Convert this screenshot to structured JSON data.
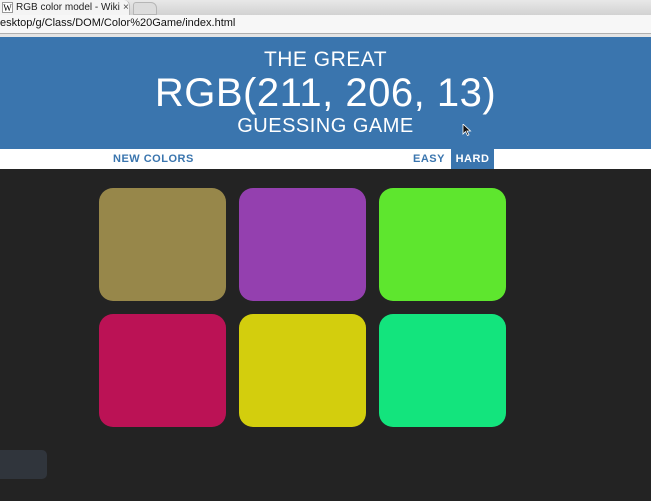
{
  "browser": {
    "tab_title": "RGB color model - Wikipe",
    "tab_favicon": "W",
    "tab_close": "×",
    "url": "esktop/g/Class/DOM/Color%20Game/index.html"
  },
  "header": {
    "line1": "The Great",
    "rgb_display": "RGB(211, 206, 13)",
    "line3": "Guessing Game"
  },
  "stripe": {
    "new_colors": "New Colors",
    "easy": "Easy",
    "hard": "Hard",
    "selected_mode": "Hard"
  },
  "squares": [
    {
      "color": "#97874a"
    },
    {
      "color": "#9440af"
    },
    {
      "color": "#5ee62e"
    },
    {
      "color": "#bb1255"
    },
    {
      "color": "#d3ce0d"
    },
    {
      "color": "#13e47d"
    }
  ],
  "colors": {
    "header_bg": "#3a75ae",
    "body_bg": "#232323",
    "stripe_bg": "#ffffff"
  },
  "icons": {
    "favicon": "wikipedia-w-icon",
    "cursor": "mouse-pointer-icon"
  }
}
